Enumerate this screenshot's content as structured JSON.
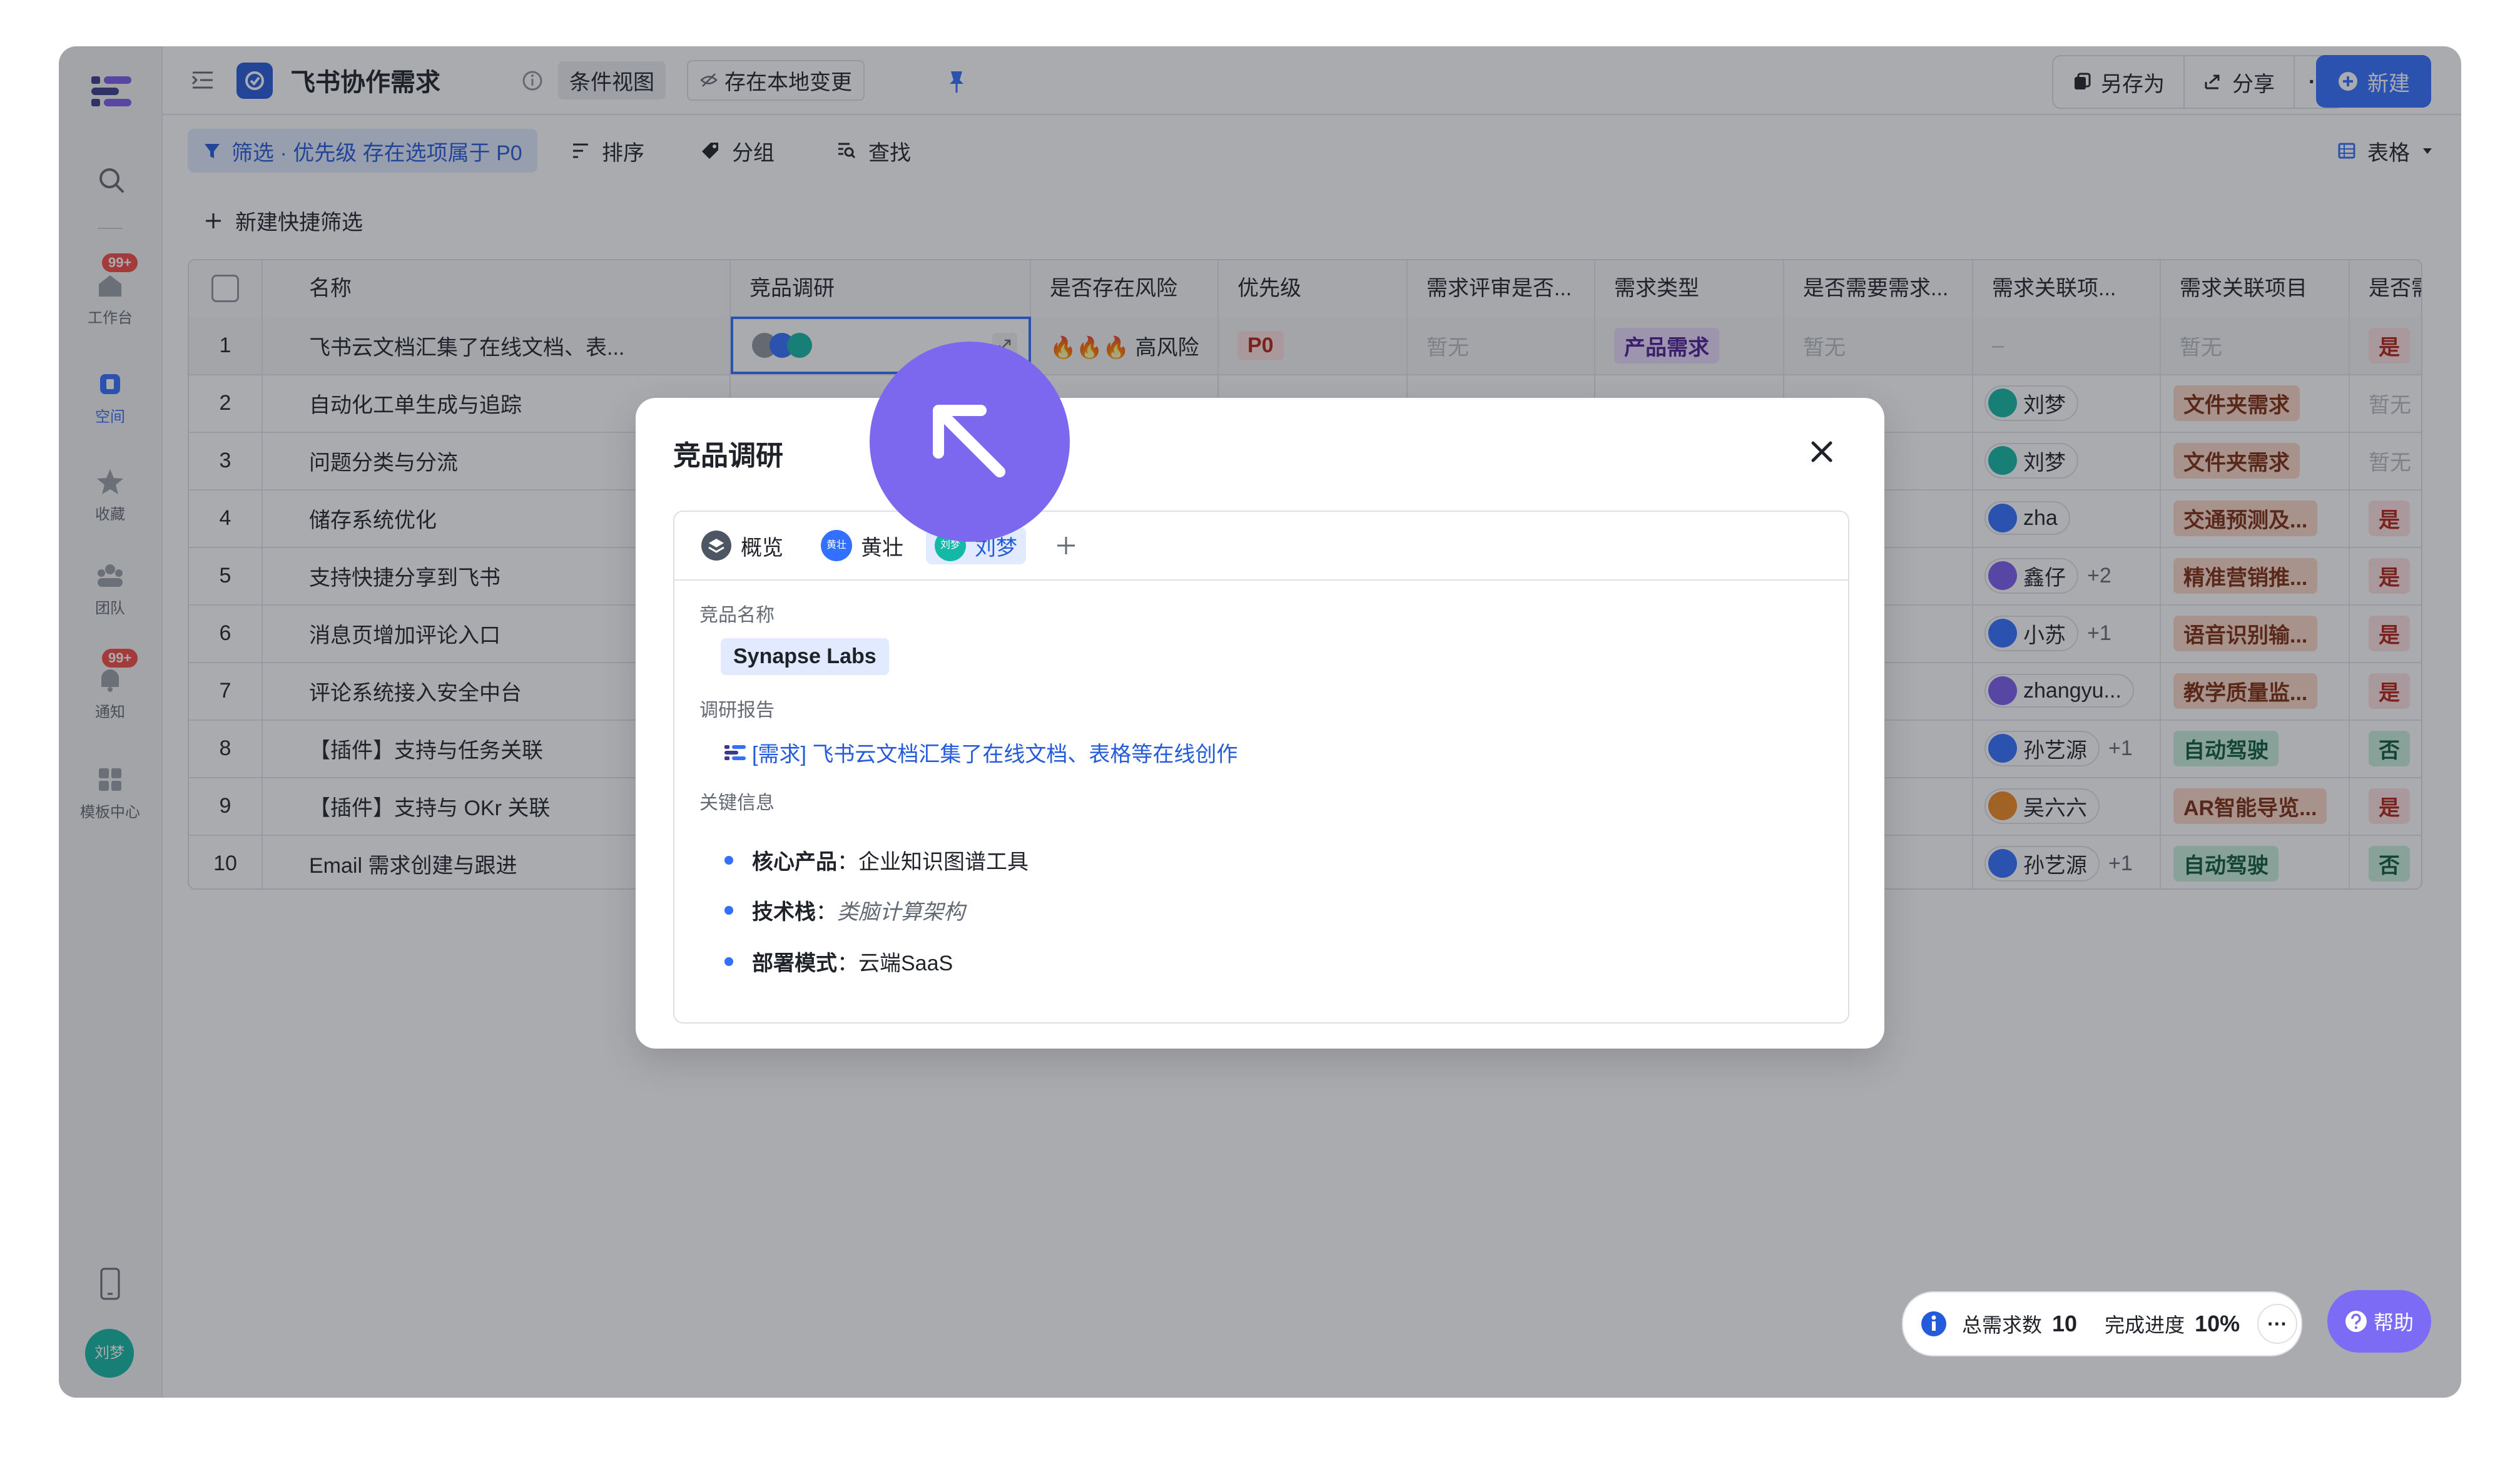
{
  "app": {
    "title": "飞书协作需求",
    "view_chip": "条件视图",
    "local_change_chip": "存在本地变更",
    "save_as": "另存为",
    "share": "分享",
    "more": "···",
    "new": "新建"
  },
  "rail": {
    "items": [
      {
        "label": "工作台",
        "badge": "99+"
      },
      {
        "label": "空间"
      },
      {
        "label": "收藏"
      },
      {
        "label": "团队"
      },
      {
        "label": "通知",
        "badge": "99+"
      },
      {
        "label": "模板中心"
      }
    ],
    "avatar": "刘梦"
  },
  "toolbar": {
    "filter": "筛选 · 优先级 存在选项属于 P0",
    "sort": "排序",
    "group": "分组",
    "find": "查找",
    "view_type": "表格",
    "quick_filter": "新建快捷筛选"
  },
  "table": {
    "columns": [
      "名称",
      "竞品调研",
      "是否存在风险",
      "优先级",
      "需求评审是否...",
      "需求类型",
      "是否需要需求...",
      "需求关联项...",
      "需求关联项目",
      "是否需要UX..."
    ],
    "rows": [
      {
        "no": "1",
        "name": "飞书云文档汇集了在线文档、表...",
        "risk": "🔥🔥🔥 高风险",
        "priority": "P0",
        "review": "暂无",
        "type": "产品需求",
        "need": "暂无",
        "assignee": "–",
        "project": "暂无",
        "ux": "是"
      },
      {
        "no": "2",
        "name": "自动化工单生成与追踪",
        "assignee": "刘梦",
        "project": "文件夹需求",
        "ux": "暂无"
      },
      {
        "no": "3",
        "name": "问题分类与分流",
        "assignee": "刘梦",
        "project": "文件夹需求",
        "ux": "暂无"
      },
      {
        "no": "4",
        "name": "储存系统优化",
        "assignee": "zha",
        "project": "交通预测及...",
        "ux": "是"
      },
      {
        "no": "5",
        "name": "支持快捷分享到飞书",
        "assignee": "鑫仔",
        "extra": "+2",
        "project": "精准营销推...",
        "ux": "是"
      },
      {
        "no": "6",
        "name": "消息页增加评论入口",
        "assignee": "小苏",
        "extra": "+1",
        "project": "语音识别输...",
        "ux": "是"
      },
      {
        "no": "7",
        "name": "评论系统接入安全中台",
        "assignee": "zhangyu...",
        "project": "教学质量监...",
        "ux": "是"
      },
      {
        "no": "8",
        "name": "【插件】支持与任务关联",
        "assignee": "孙艺源",
        "extra": "+1",
        "project": "自动驾驶",
        "ux": "否"
      },
      {
        "no": "9",
        "name": "【插件】支持与 OKr 关联",
        "assignee": "吴六六",
        "project": "AR智能导览...",
        "ux": "是"
      },
      {
        "no": "10",
        "name": "Email 需求创建与跟进",
        "assignee": "孙艺源",
        "extra": "+1",
        "project": "自动驾驶",
        "ux": "否"
      }
    ]
  },
  "modal": {
    "title": "竞品调研",
    "tabs": [
      "概览",
      "黄壮",
      "刘梦"
    ],
    "tab_avatars": [
      "黄壮",
      "刘梦"
    ],
    "fields": {
      "competitor_label": "竞品名称",
      "competitor_value": "Synapse Labs",
      "report_label": "调研报告",
      "report_link": "[需求] 飞书云文档汇集了在线文档、表格等在线创作",
      "key_label": "关键信息",
      "bullets": [
        {
          "k": "核心产品",
          "v": "企业知识图谱工具"
        },
        {
          "k": "技术栈",
          "v": "类脑计算架构"
        },
        {
          "k": "部署模式",
          "v": "云端SaaS"
        }
      ]
    }
  },
  "status": {
    "total_label": "总需求数",
    "total_value": "10",
    "progress_label": "完成进度",
    "progress_value": "10%",
    "more": "···",
    "help": "帮助"
  },
  "colors": {
    "accent": "#3370ff",
    "cursor": "#7b68ee"
  }
}
